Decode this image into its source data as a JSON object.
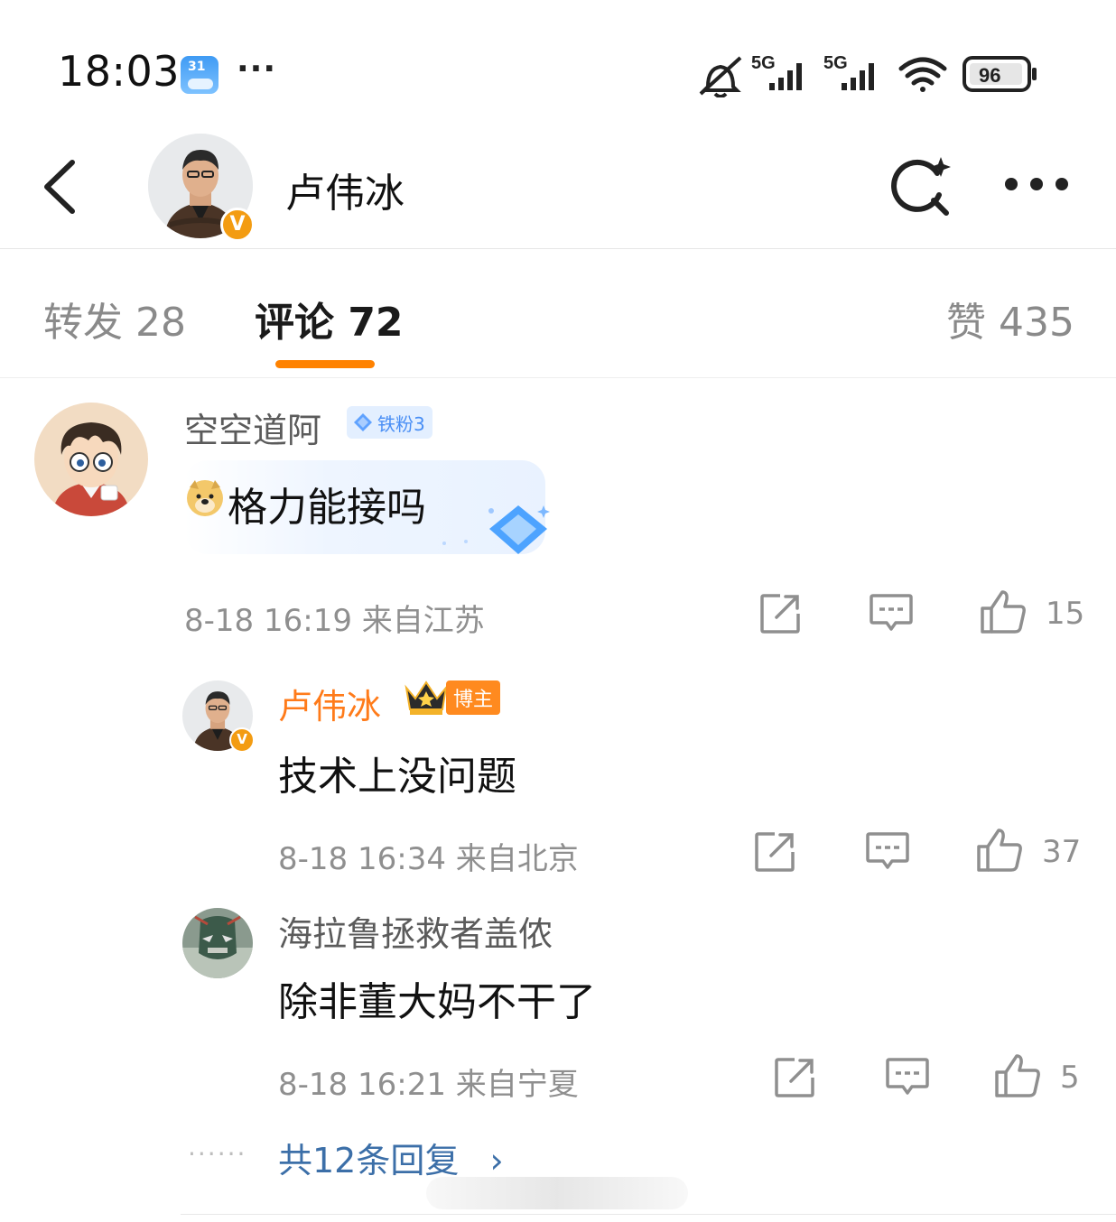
{
  "status_bar": {
    "time": "18:03",
    "calendar_day": "31",
    "more": "···",
    "network_1": "5G",
    "network_2": "5G",
    "battery": "96"
  },
  "nav": {
    "title": "卢伟冰",
    "verified": "V"
  },
  "tabs": [
    {
      "label": "转发 28"
    },
    {
      "label": "评论 72"
    },
    {
      "label": "赞 435"
    }
  ],
  "comment": {
    "author": "空空道阿",
    "fan_badge": "铁粉3",
    "text": "格力能接吗",
    "time_location": "8-18 16:19 来自江苏",
    "likes": "15"
  },
  "replies": [
    {
      "author": "卢伟冰",
      "badge": "博主",
      "text": "技术上没问题",
      "time_location": "8-18 16:34 来自北京",
      "likes": "37"
    },
    {
      "author": "海拉鲁拯救者盖侬",
      "text": "除非董大妈不干了",
      "time_location": "8-18 16:21 来自宁夏",
      "likes": "5"
    }
  ],
  "more_replies": "共12条回复",
  "more_replies_chevron": "›",
  "more_dots": "······",
  "colors": {
    "accent_orange": "#ff8200",
    "link_blue": "#3c6fa8",
    "fan_badge_blue": "#4a8ff5"
  }
}
